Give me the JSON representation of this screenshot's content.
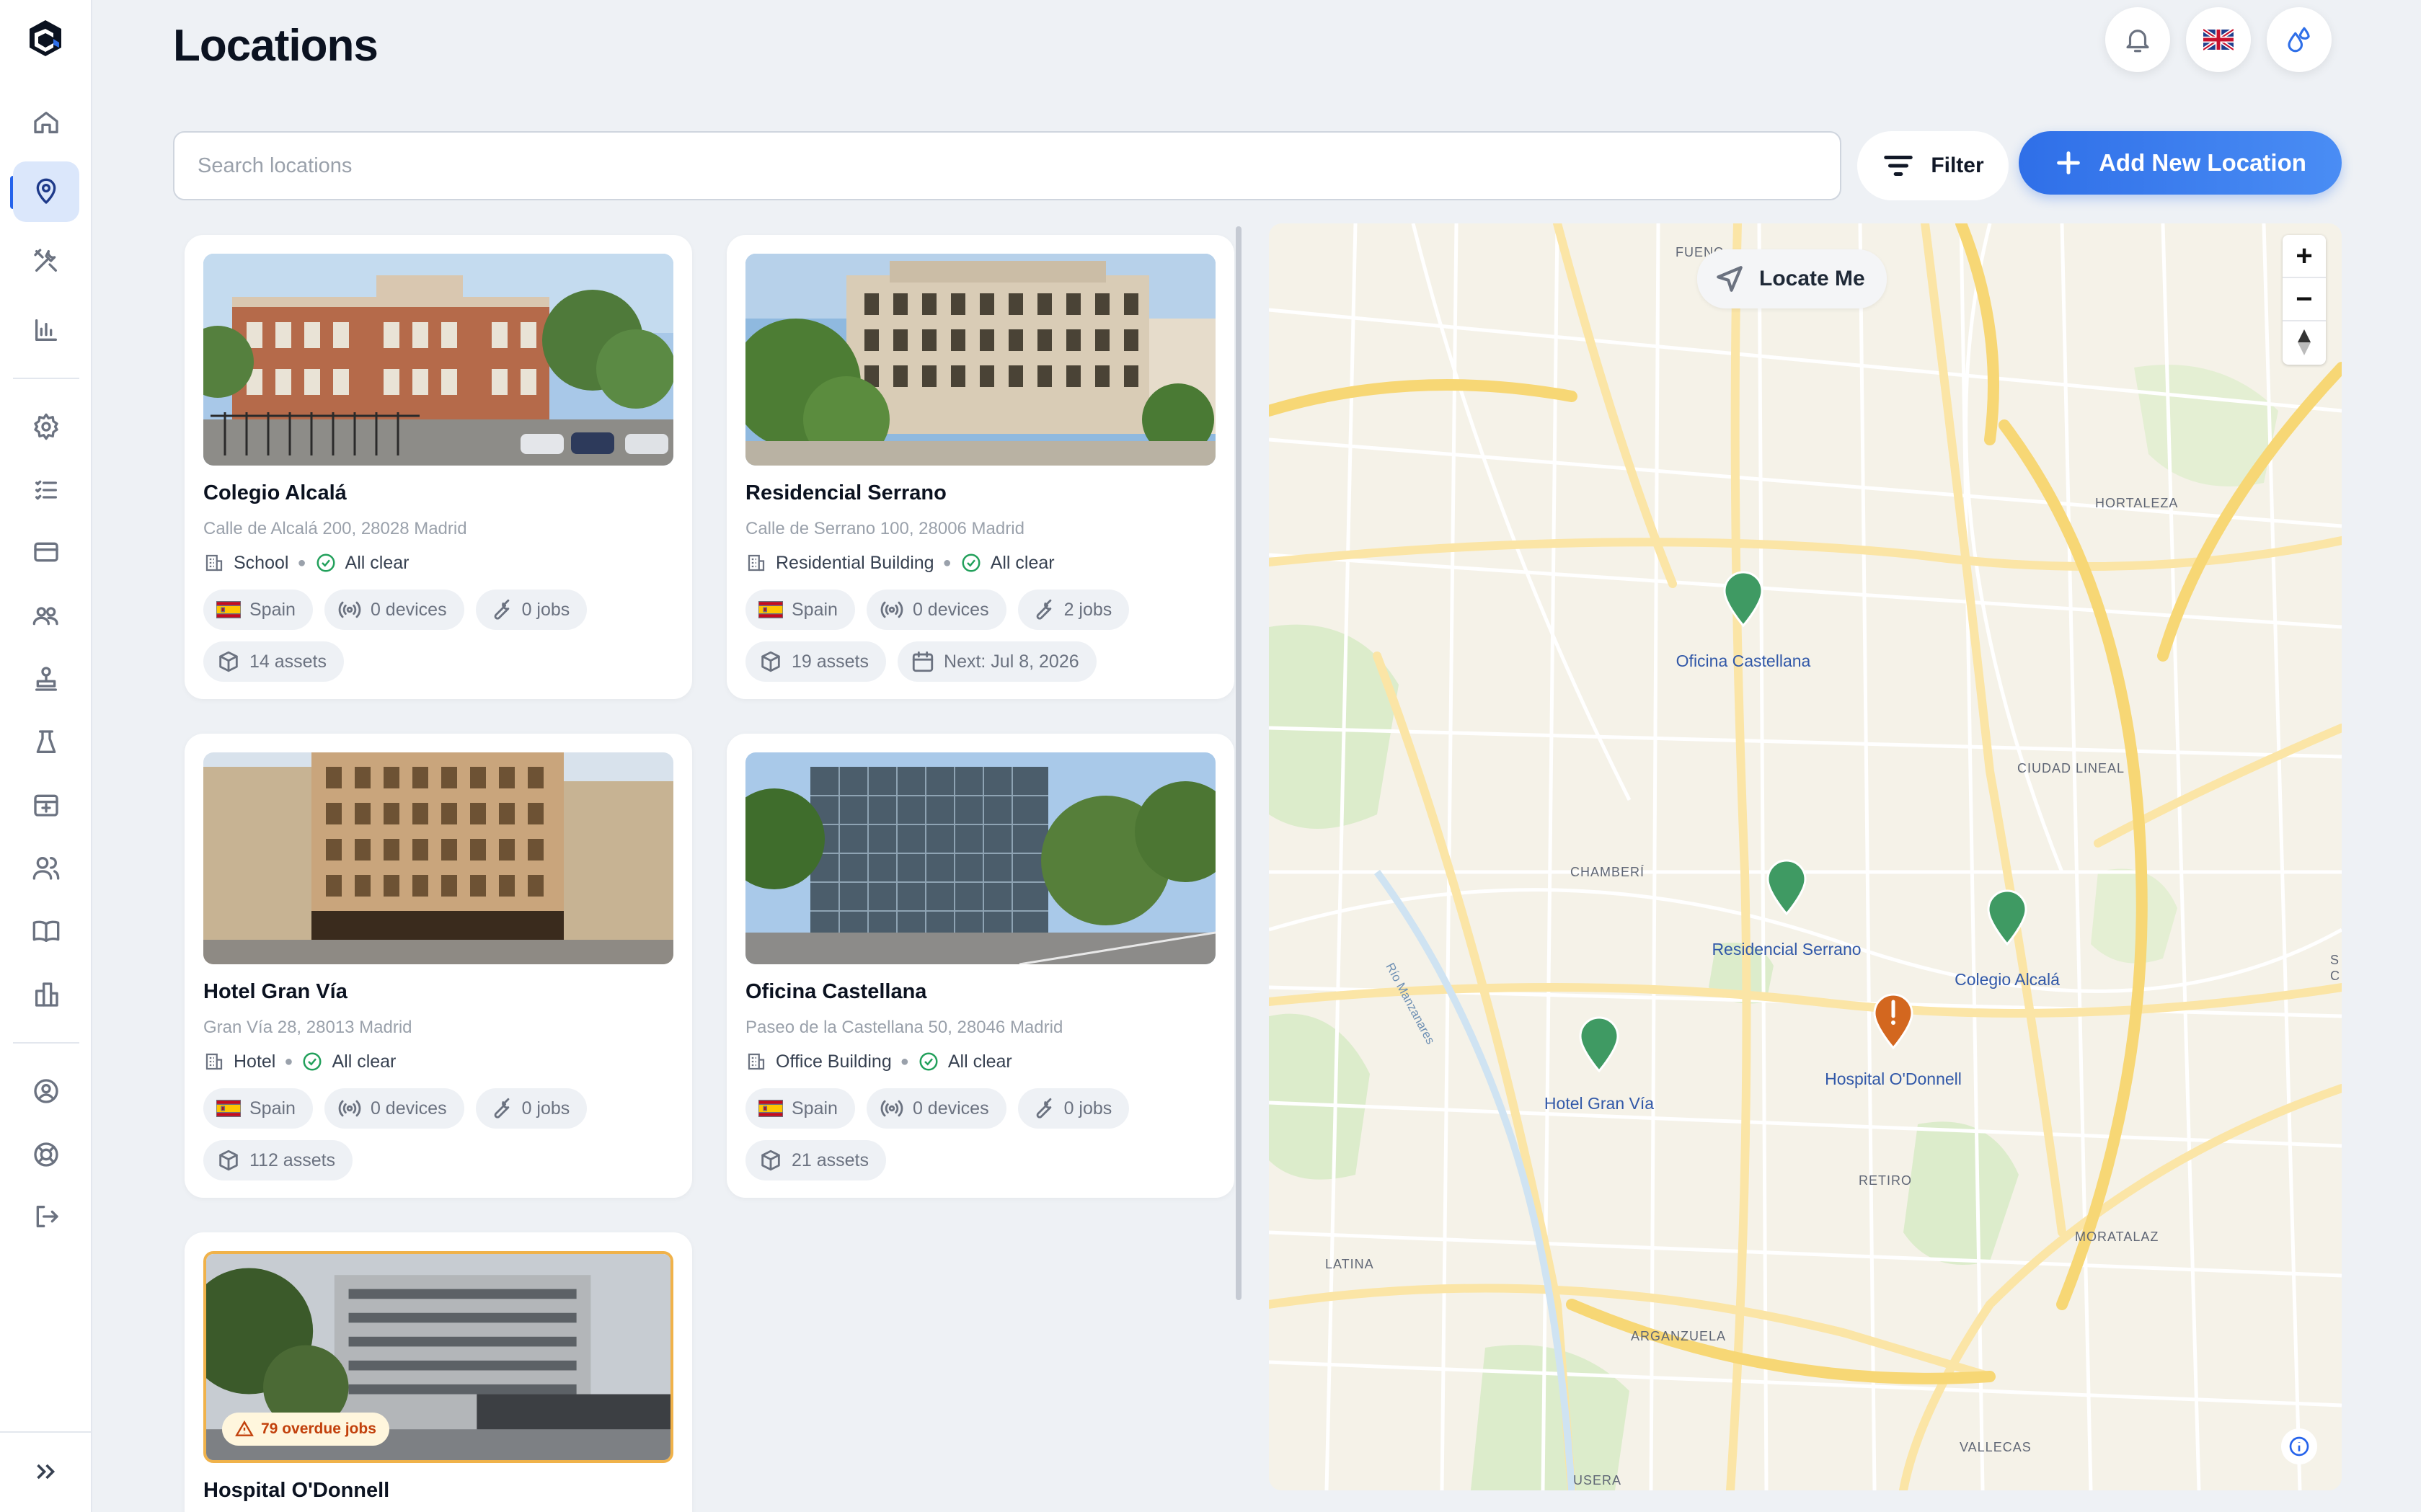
{
  "app": {
    "title": "Locations"
  },
  "header": {
    "notifications_icon": "bell-icon",
    "language_icon": "uk-flag-icon",
    "profile_icon": "water-drops-icon"
  },
  "sidebar": {
    "items": [
      {
        "name": "home",
        "icon": "home-icon"
      },
      {
        "name": "locations",
        "icon": "map-pin-icon",
        "active": true
      },
      {
        "name": "tools",
        "icon": "tools-icon"
      },
      {
        "name": "reports",
        "icon": "bar-chart-icon"
      },
      {
        "name": "settings",
        "icon": "gear-icon"
      },
      {
        "name": "checklists",
        "icon": "list-check-icon"
      },
      {
        "name": "billing",
        "icon": "credit-card-icon"
      },
      {
        "name": "teams",
        "icon": "group-icon"
      },
      {
        "name": "stamp",
        "icon": "stamp-icon"
      },
      {
        "name": "lab",
        "icon": "flask-icon"
      },
      {
        "name": "calendar",
        "icon": "calendar-icon"
      },
      {
        "name": "users",
        "icon": "users-icon"
      },
      {
        "name": "docs",
        "icon": "book-icon"
      },
      {
        "name": "buildings",
        "icon": "buildings-icon"
      },
      {
        "name": "account",
        "icon": "user-circle-icon"
      },
      {
        "name": "support",
        "icon": "lifebuoy-icon"
      },
      {
        "name": "logout",
        "icon": "logout-icon"
      }
    ]
  },
  "toolbar": {
    "search_placeholder": "Search locations",
    "filter_label": "Filter",
    "add_label": "Add New Location"
  },
  "cards": [
    {
      "name": "Colegio Alcalá",
      "address": "Calle de Alcalá 200, 28028 Madrid",
      "type": "School",
      "status": "All clear",
      "country": "Spain",
      "devices": "0 devices",
      "jobs": "0 jobs",
      "assets": "14 assets"
    },
    {
      "name": "Residencial Serrano",
      "address": "Calle de Serrano 100, 28006 Madrid",
      "type": "Residential Building",
      "status": "All clear",
      "country": "Spain",
      "devices": "0 devices",
      "jobs": "2 jobs",
      "assets": "19 assets",
      "next": "Next: Jul 8, 2026"
    },
    {
      "name": "Hotel Gran Vía",
      "address": "Gran Vía 28, 28013 Madrid",
      "type": "Hotel",
      "status": "All clear",
      "country": "Spain",
      "devices": "0 devices",
      "jobs": "0 jobs",
      "assets": "112 assets"
    },
    {
      "name": "Oficina Castellana",
      "address": "Paseo de la Castellana 50, 28046 Madrid",
      "type": "Office Building",
      "status": "All clear",
      "country": "Spain",
      "devices": "0 devices",
      "jobs": "0 jobs",
      "assets": "21 assets"
    },
    {
      "name": "Hospital O'Donnell",
      "overdue": "79 overdue jobs"
    }
  ],
  "map": {
    "locate_label": "Locate Me",
    "zoom_in": "+",
    "zoom_out": "−",
    "areas": [
      "FUENC",
      "HORTALEZA",
      "CIUDAD LINEAL",
      "CHAMBERÍ",
      "RETIRO",
      "MORATALAZ",
      "LATINA",
      "ARGANZUELA",
      "VALLECAS",
      "USERA",
      "S",
      "C"
    ],
    "river": "Río Manzanares",
    "pins": [
      {
        "label": "Oficina Castellana",
        "status": "ok"
      },
      {
        "label": "Residencial Serrano",
        "status": "ok"
      },
      {
        "label": "Colegio Alcalá",
        "status": "ok"
      },
      {
        "label": "Hotel Gran Vía",
        "status": "ok"
      },
      {
        "label": "Hospital O'Donnell",
        "status": "warning"
      }
    ],
    "colors": {
      "ok": "#3f9a63",
      "warning": "#d3671f"
    }
  },
  "colors": {
    "accent": "#2f6fe8",
    "status_ok": "#22a05b",
    "overdue": "#c2410c"
  }
}
